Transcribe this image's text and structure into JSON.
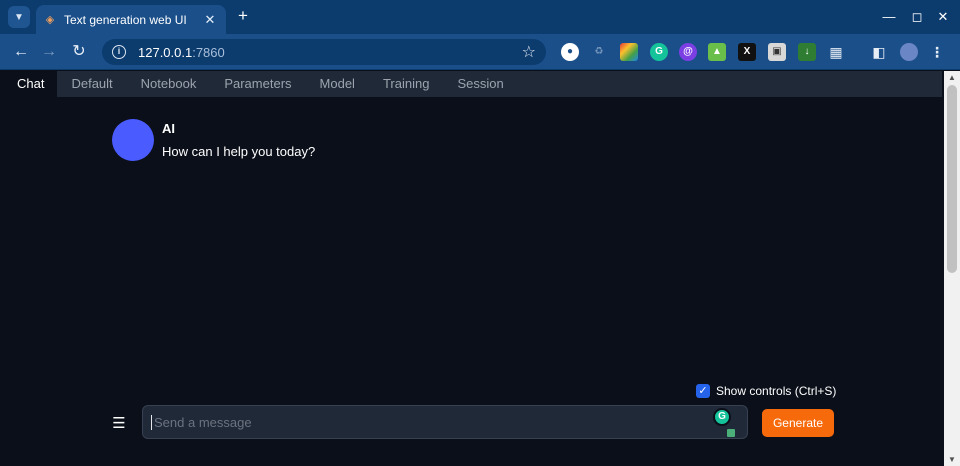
{
  "browser": {
    "tab_title": "Text generation web UI",
    "url_host": "127.0.0.1",
    "url_port": ":7860",
    "tab_favicon": "layers-icon"
  },
  "app": {
    "tabs": [
      {
        "label": "Chat",
        "active": true
      },
      {
        "label": "Default"
      },
      {
        "label": "Notebook"
      },
      {
        "label": "Parameters"
      },
      {
        "label": "Model"
      },
      {
        "label": "Training"
      },
      {
        "label": "Session"
      }
    ],
    "message": {
      "author": "AI",
      "text": "How can I help you today?",
      "avatar_color": "#4a5cff"
    },
    "controls": {
      "show_controls_label": "Show controls (Ctrl+S)",
      "show_controls_checked": true
    },
    "input": {
      "placeholder": "Send a message",
      "value": ""
    },
    "generate_label": "Generate",
    "colors": {
      "accent": "#f76a0c",
      "background": "#0b0f19",
      "chrome": "#1a4f8a"
    }
  }
}
